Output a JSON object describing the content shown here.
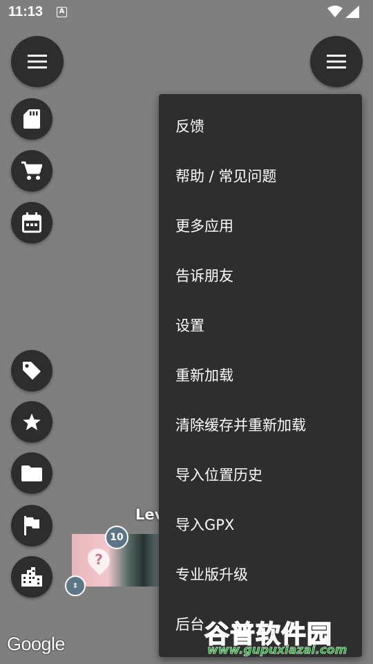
{
  "status_bar": {
    "time": "11:13",
    "notification_letter": "A"
  },
  "map": {
    "level_label": "Lev",
    "cluster_count": "10",
    "photo_marker_glyph": "?",
    "small_marker_glyph": "⇕",
    "attribution": "Google"
  },
  "left_buttons": [
    {
      "icon": "hamburger-menu-icon"
    },
    {
      "icon": "sd-card-icon"
    },
    {
      "icon": "shopping-cart-icon"
    },
    {
      "icon": "calendar-icon"
    },
    {
      "icon": "tag-icon"
    },
    {
      "icon": "star-icon"
    },
    {
      "icon": "folder-icon"
    },
    {
      "icon": "flag-icon"
    },
    {
      "icon": "city-icon"
    }
  ],
  "right_button": {
    "icon": "hamburger-menu-icon"
  },
  "menu": {
    "items": [
      {
        "label": "反馈"
      },
      {
        "label": "帮助 / 常见问题"
      },
      {
        "label": "更多应用"
      },
      {
        "label": "告诉朋友"
      },
      {
        "label": "设置"
      },
      {
        "label": "重新加载"
      },
      {
        "label": "清除缓存并重新加载"
      },
      {
        "label": "导入位置历史"
      },
      {
        "label": "导入GPX"
      },
      {
        "label": "专业版升级"
      },
      {
        "label": "后台"
      }
    ]
  },
  "watermark": {
    "title": "谷普软件园",
    "url": "www.gupuxiazai.com"
  },
  "colors": {
    "map_background": "#7f7f7f",
    "button_background": "#2d2d2d",
    "menu_background": "#2e2e2e",
    "badge": "#5d7686",
    "watermark_green": "#2fa83f"
  }
}
